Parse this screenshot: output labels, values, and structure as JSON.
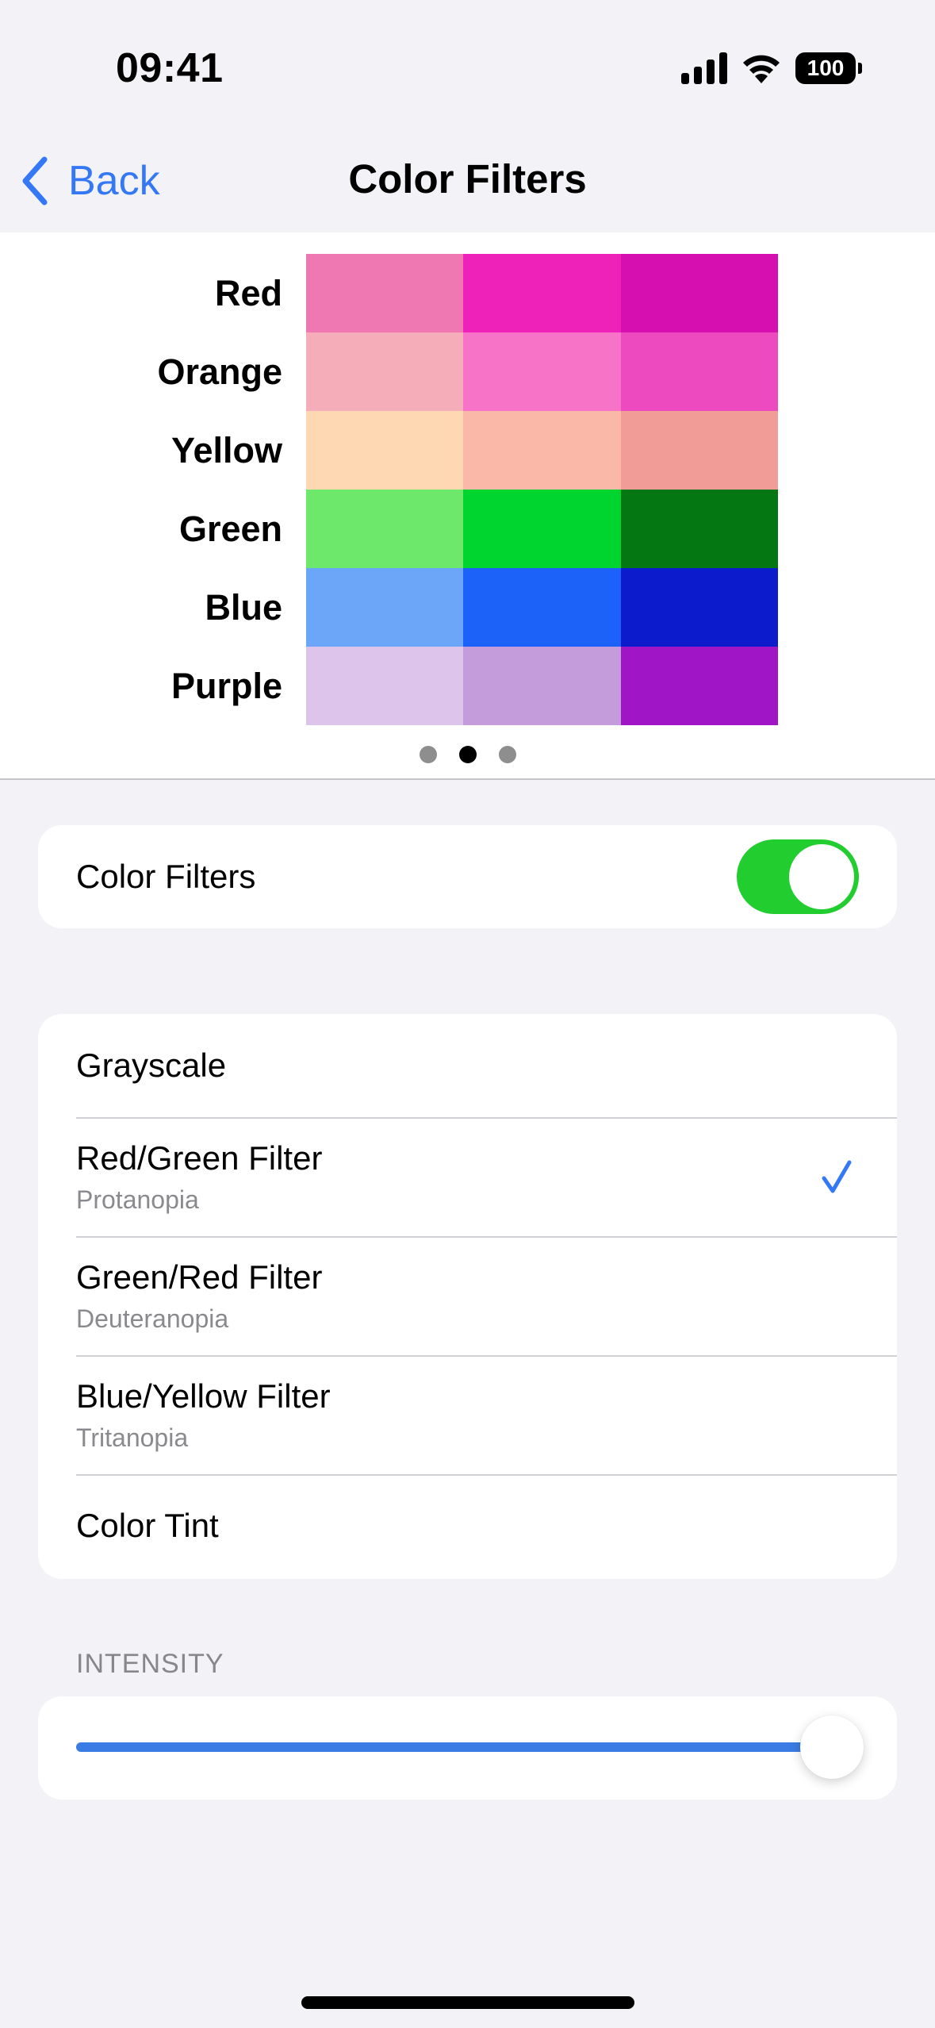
{
  "status_bar": {
    "time": "09:41",
    "battery": "100",
    "icons": [
      "cellular-signal-icon",
      "wifi-icon",
      "battery-icon"
    ]
  },
  "nav": {
    "back_label": "Back",
    "title": "Color Filters",
    "back_icon": "chevron-left-icon",
    "accent_color": "#3478f6"
  },
  "swatches": {
    "rows": [
      {
        "label": "Red",
        "colors": [
          "#f078b2",
          "#ee22b8",
          "#d610b0"
        ]
      },
      {
        "label": "Orange",
        "colors": [
          "#f6adba",
          "#f673c8",
          "#ee4ac0"
        ]
      },
      {
        "label": "Yellow",
        "colors": [
          "#fdd8b3",
          "#fab8a8",
          "#f29c98"
        ]
      },
      {
        "label": "Green",
        "colors": [
          "#6ee86a",
          "#00d42e",
          "#047612"
        ]
      },
      {
        "label": "Blue",
        "colors": [
          "#6ca6f8",
          "#1c62f8",
          "#0c1ccc"
        ]
      },
      {
        "label": "Purple",
        "colors": [
          "#dcc4ea",
          "#c49cdc",
          "#a016c6"
        ]
      }
    ],
    "pages": 3,
    "current_page": 2
  },
  "toggle": {
    "label": "Color Filters",
    "on": true,
    "on_color": "#22cd2f"
  },
  "filters": {
    "items": [
      {
        "label": "Grayscale",
        "sub": null,
        "selected": false
      },
      {
        "label": "Red/Green Filter",
        "sub": "Protanopia",
        "selected": true
      },
      {
        "label": "Green/Red Filter",
        "sub": "Deuteranopia",
        "selected": false
      },
      {
        "label": "Blue/Yellow Filter",
        "sub": "Tritanopia",
        "selected": false
      },
      {
        "label": "Color Tint",
        "sub": null,
        "selected": false
      }
    ]
  },
  "intensity": {
    "header": "INTENSITY",
    "value": 1.0,
    "fill_color": "#3a7ce3"
  }
}
